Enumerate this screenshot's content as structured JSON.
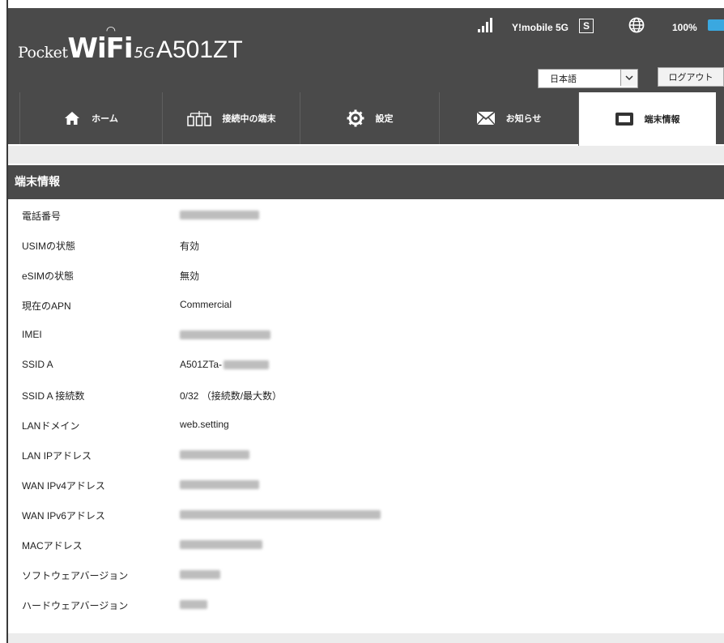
{
  "header": {
    "logo_pocket": "Pocket",
    "logo_wifi": "WiFi",
    "logo_5g": "5G",
    "logo_model": "A501ZT",
    "carrier": "Y!mobile 5G",
    "sim_label": "S",
    "battery_percent": "100%",
    "battery_level": 1.0,
    "language_selected": "日本語",
    "logout_label": "ログアウト",
    "accent_color": "#3aa8e0"
  },
  "nav": {
    "tabs": [
      {
        "label": "ホーム",
        "icon": "home-icon"
      },
      {
        "label": "接続中の端末",
        "icon": "devices-icon"
      },
      {
        "label": "設定",
        "icon": "gear-icon"
      },
      {
        "label": "お知らせ",
        "icon": "mail-icon"
      },
      {
        "label": "端末情報",
        "icon": "device-info-icon",
        "active": true
      }
    ]
  },
  "section": {
    "title": "端末情報"
  },
  "info_rows": [
    {
      "label": "電話番号",
      "value": "",
      "masked": true
    },
    {
      "label": "USIMの状態",
      "value": "有効"
    },
    {
      "label": "eSIMの状態",
      "value": "無効"
    },
    {
      "label": "現在のAPN",
      "value": "Commercial"
    },
    {
      "label": "IMEI",
      "value": "",
      "masked": true
    },
    {
      "label": "SSID A",
      "value": "A501ZTa-",
      "masked": true
    },
    {
      "label": "SSID A 接続数",
      "value": "0/32 （接続数/最大数）"
    },
    {
      "label": "LANドメイン",
      "value": "web.setting"
    },
    {
      "label": "LAN IPアドレス",
      "value": "",
      "masked": true
    },
    {
      "label": "WAN IPv4アドレス",
      "value": "",
      "masked": true
    },
    {
      "label": "WAN IPv6アドレス",
      "value": "",
      "masked": true
    },
    {
      "label": "MACアドレス",
      "value": "",
      "masked": true
    },
    {
      "label": "ソフトウェアバージョン",
      "value": "",
      "masked": true
    },
    {
      "label": "ハードウェアバージョン",
      "value": "",
      "masked": true
    }
  ]
}
